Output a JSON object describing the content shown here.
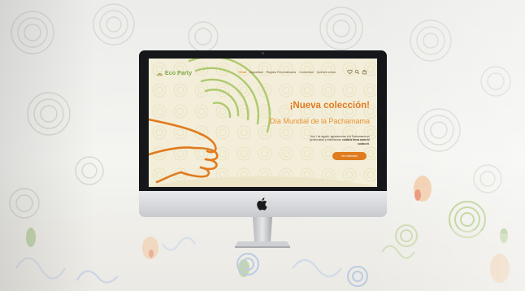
{
  "site": {
    "logo_text": "Eco Party",
    "nav": [
      "Tienda",
      "Mayoristas",
      "Regalos Personalizados",
      "Comunidad",
      "Quiénes somos"
    ],
    "nav_icons": [
      "heart-icon",
      "search-icon",
      "bag-icon"
    ],
    "hero_title": "¡Nueva colección!",
    "hero_subtitle": "Día Mundial de la Pachamama",
    "hero_text_1": "Hoy 1 de agosto, agradecemos a la Pachamama su generosidad y enseñanzas; ",
    "hero_text_bold": "cuida la tierra como te cuida a ti",
    "hero_text_2": ".",
    "cta_label": "Ver colección"
  },
  "colors": {
    "accent": "#e07b1f",
    "brand_green": "#7fa64a",
    "screen_bg": "#f2ecd6",
    "bezel": "#16171a"
  }
}
